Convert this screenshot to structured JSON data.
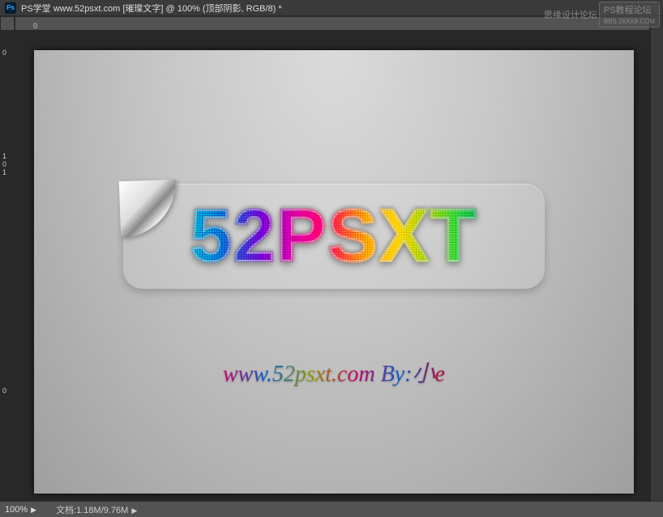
{
  "titlebar": {
    "app_icon": "Ps",
    "title": "PS学堂  www.52psxt.com [璀璨文字] @ 100% (顶部阴影, RGB/8) *"
  },
  "watermarks": {
    "left": "思缘设计论坛",
    "right_label": "PS教程论坛",
    "right_url": "BBS.16XX8.COM"
  },
  "rulers": {
    "h_ticks": [
      "0"
    ],
    "v_ticks": [
      "0",
      "1",
      "0",
      "1",
      "0"
    ]
  },
  "artwork": {
    "main_text": "52PSXT",
    "sub_text": "www.52psxt.com   By:小e"
  },
  "statusbar": {
    "zoom": "100%",
    "doc_label": "文档:",
    "doc_size": "1.18M/9.76M"
  }
}
